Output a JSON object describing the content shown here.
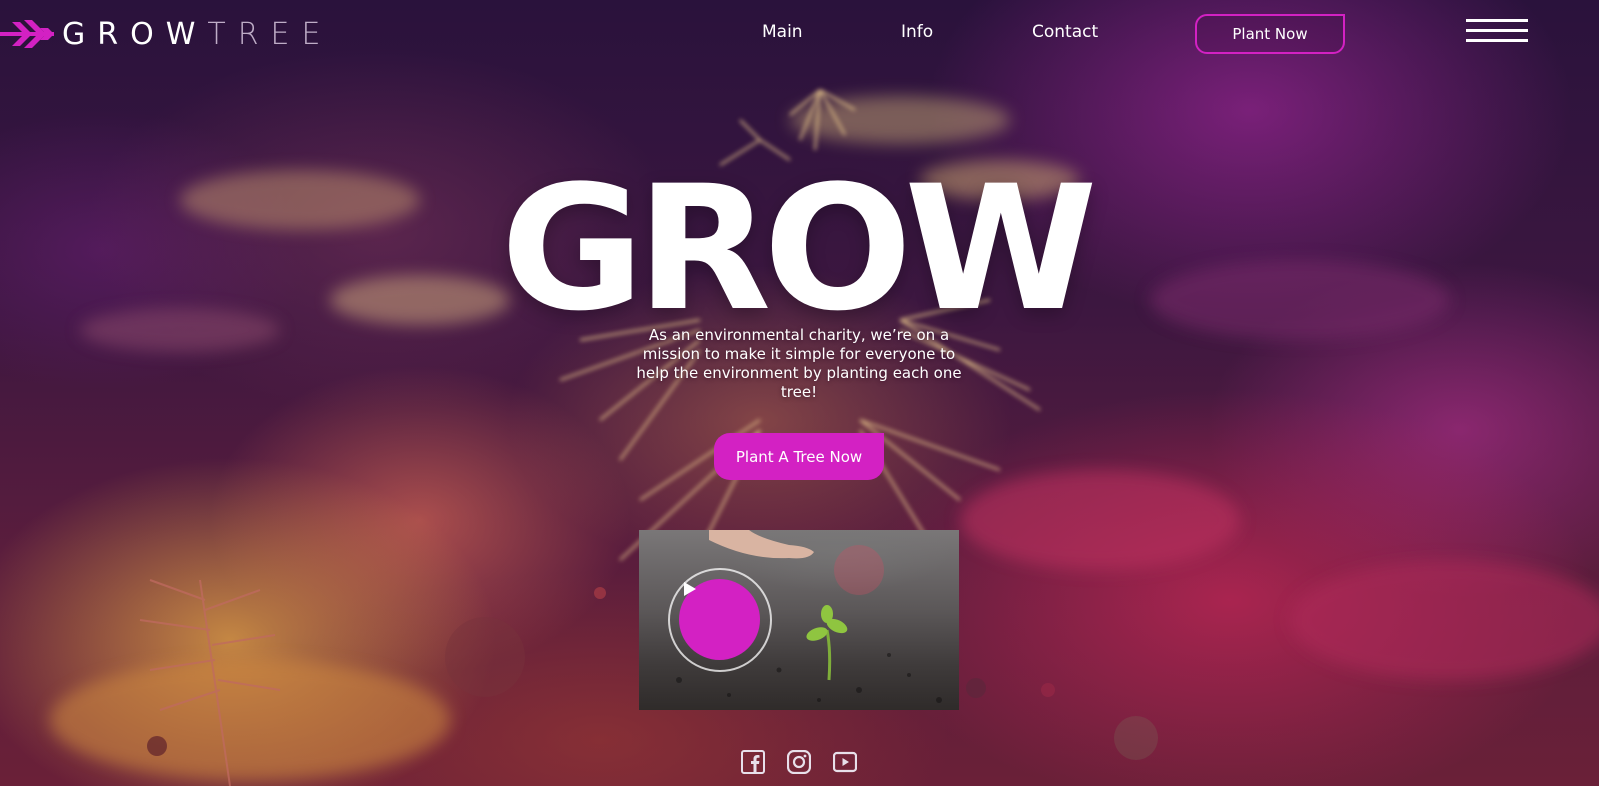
{
  "brand": {
    "logo_icon": "arrow-leaf-logo-icon",
    "name_part1": "GROW",
    "name_part2": "TREE"
  },
  "nav": {
    "items": [
      {
        "label": "Main"
      },
      {
        "label": "Info"
      },
      {
        "label": "Contact"
      }
    ],
    "cta_label": "Plant Now",
    "menu_icon": "hamburger-menu-icon"
  },
  "hero": {
    "title": "GROW",
    "description": "As an environmental charity, we’re on a mission to make it simple for everyone to help the environment by planting each one tree!",
    "cta_label": "Plant A Tree Now"
  },
  "video": {
    "play_icon": "play-icon"
  },
  "social": [
    {
      "icon": "facebook-icon"
    },
    {
      "icon": "instagram-icon"
    },
    {
      "icon": "youtube-icon"
    }
  ],
  "colors": {
    "accent": "#d321c3",
    "text": "#ffffff"
  }
}
